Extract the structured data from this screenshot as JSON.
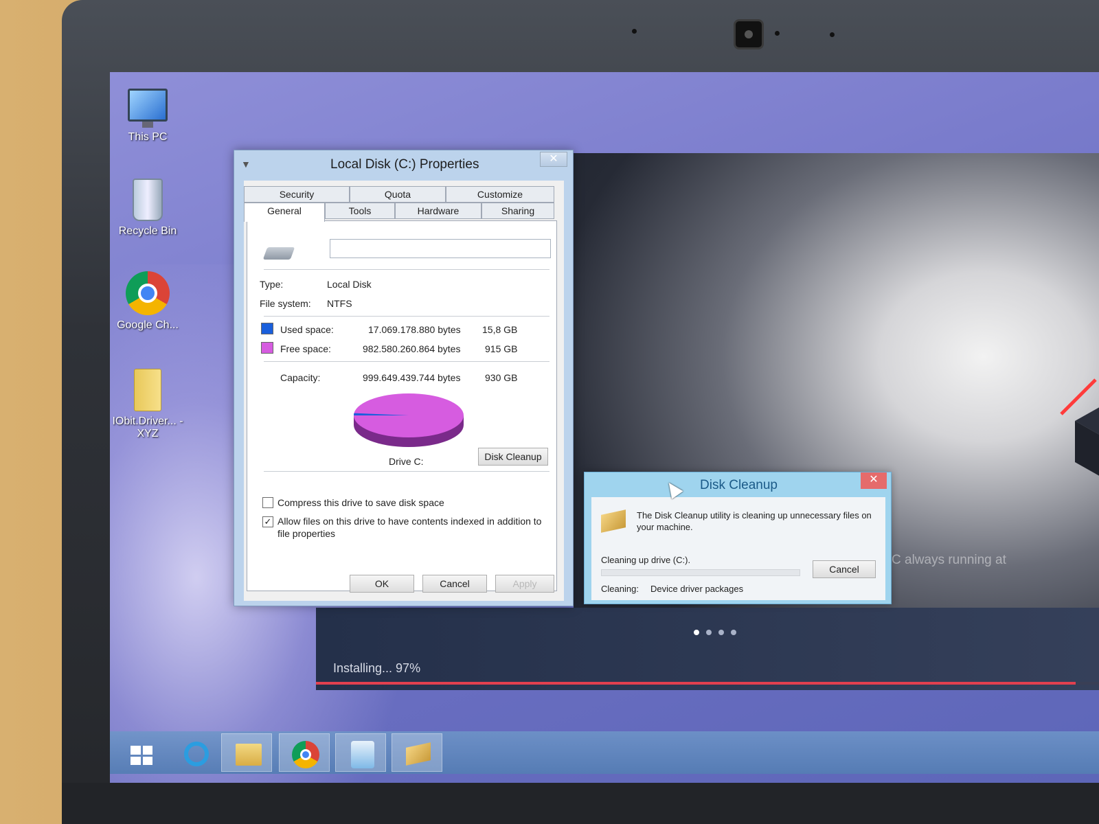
{
  "desktop": {
    "icons": [
      {
        "label": "This PC",
        "icon": "computer-icon"
      },
      {
        "label": "Recycle Bin",
        "icon": "recycle-bin-icon"
      },
      {
        "label": "Google Ch...",
        "icon": "chrome-icon"
      },
      {
        "label": "IObit.Driver... - XYZ",
        "icon": "folder-icon"
      }
    ]
  },
  "installer": {
    "status": "Installing... 97%",
    "progress": 0.97,
    "background_text": "C always running at",
    "slides_total": 4,
    "slide_active": 1
  },
  "properties_dialog": {
    "title": "Local Disk (C:) Properties",
    "close_label": "✕",
    "tabs_row1": [
      "Security",
      "Quota",
      "Customize"
    ],
    "tabs_row2": [
      "General",
      "Tools",
      "Hardware",
      "Sharing"
    ],
    "active_tab": "General",
    "drive_name_value": "",
    "type_label": "Type:",
    "type_value": "Local Disk",
    "fs_label": "File system:",
    "fs_value": "NTFS",
    "used_label": "Used space:",
    "used_bytes": "17.069.178.880 bytes",
    "used_gb": "15,8 GB",
    "free_label": "Free space:",
    "free_bytes": "982.580.260.864 bytes",
    "free_gb": "915 GB",
    "capacity_label": "Capacity:",
    "capacity_bytes": "999.649.439.744 bytes",
    "capacity_gb": "930 GB",
    "drive_label": "Drive C:",
    "disk_cleanup_label": "Disk Cleanup",
    "compress_label": "Compress this drive to save disk space",
    "compress_checked": false,
    "index_label": "Allow files on this drive to have contents indexed in addition to file properties",
    "index_checked": true,
    "ok_label": "OK",
    "cancel_label": "Cancel",
    "apply_label": "Apply",
    "colors": {
      "used": "#1a5fdc",
      "free": "#d65ce0"
    }
  },
  "cleanup_dialog": {
    "title": "Disk Cleanup",
    "close_label": "✕",
    "message": "The Disk Cleanup utility is cleaning up unnecessary files on your machine.",
    "drive_line": "Cleaning up drive  (C:).",
    "cancel_label": "Cancel",
    "cleaning_label": "Cleaning:",
    "cleaning_value": "Device driver packages"
  },
  "taskbar": {
    "items": [
      "start-icon",
      "internet-explorer-icon",
      "file-explorer-icon",
      "chrome-icon",
      "iobit-driver-booster-icon",
      "disk-cleanup-icon"
    ]
  }
}
